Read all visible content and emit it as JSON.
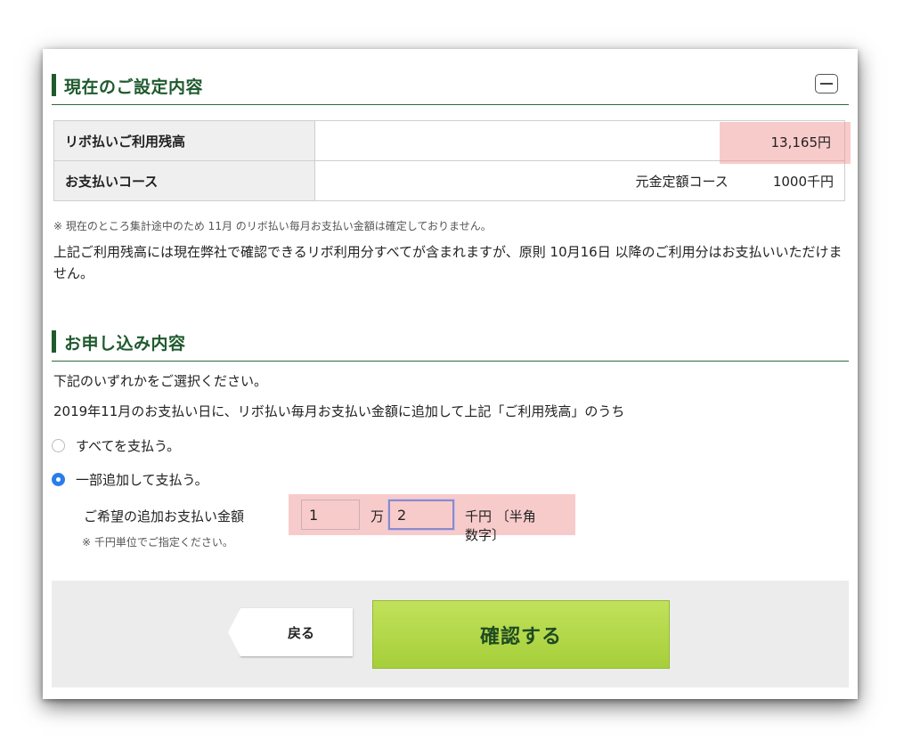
{
  "current_settings": {
    "title": "現在のご設定内容",
    "rows": [
      {
        "label": "リボ払いご利用残高",
        "value": "13,165円"
      },
      {
        "label": "お支払いコース",
        "course": "元金定額コース",
        "value": "1000千円"
      }
    ],
    "note": "※ 現在のところ集計途中のため 11月 のリボ払い毎月お支払い金額は確定しておりません。",
    "paragraph": "上記ご利用残高には現在弊社で確認できるリボ利用分すべてが含まれますが、原則 10月16日 以降のご利用分はお支払いいただけません。"
  },
  "application": {
    "title": "お申し込み内容",
    "instruction": "下記のいずれかをご選択ください。",
    "description": "2019年11月のお支払い日に、リボ払い毎月お支払い金額に追加して上記「ご利用残高」のうち",
    "options": [
      {
        "label": "すべてを支払う。",
        "checked": false
      },
      {
        "label": "一部追加して支払う。",
        "checked": true
      }
    ],
    "amount": {
      "label": "ご希望の追加お支払い金額",
      "man_value": "1",
      "man_unit": "万",
      "sen_value": "2",
      "sen_unit": "千円 〔半角数字〕",
      "hint": "※ 千円単位でご指定ください。"
    }
  },
  "footer": {
    "back_label": "戻る",
    "confirm_label": "確認する"
  },
  "colors": {
    "section_green": "#1f5a2e",
    "highlight": "#f08c8c",
    "confirm_button": "#b3d84a",
    "radio_checked": "#2b7de9"
  }
}
